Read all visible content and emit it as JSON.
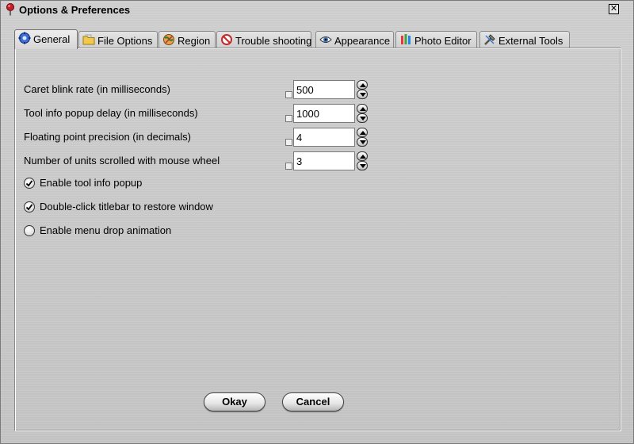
{
  "window": {
    "title": "Options & Preferences",
    "close_glyph": "✕"
  },
  "tabs": [
    {
      "label": "General",
      "icon": "gear-icon",
      "active": true
    },
    {
      "label": "File Options",
      "icon": "folder-icon",
      "active": false
    },
    {
      "label": "Region",
      "icon": "globe-icon",
      "active": false
    },
    {
      "label": "Trouble shooting",
      "icon": "no-entry-icon",
      "active": false
    },
    {
      "label": "Appearance",
      "icon": "eye-icon",
      "active": false
    },
    {
      "label": "Photo Editor",
      "icon": "brushes-icon",
      "active": false
    },
    {
      "label": "External Tools",
      "icon": "tools-icon",
      "active": false
    }
  ],
  "settings": [
    {
      "label": "Caret blink rate (in milliseconds)",
      "value": "500"
    },
    {
      "label": "Tool info popup delay (in milliseconds)",
      "value": "1000"
    },
    {
      "label": "Floating point precision (in decimals)",
      "value": "4"
    },
    {
      "label": "Number of units scrolled with mouse wheel",
      "value": "3"
    }
  ],
  "options": [
    {
      "label": "Enable tool info popup",
      "checked": true
    },
    {
      "label": "Double-click titlebar to restore window",
      "checked": true
    },
    {
      "label": "Enable menu drop animation",
      "checked": false
    }
  ],
  "buttons": {
    "ok": "Okay",
    "cancel": "Cancel"
  }
}
